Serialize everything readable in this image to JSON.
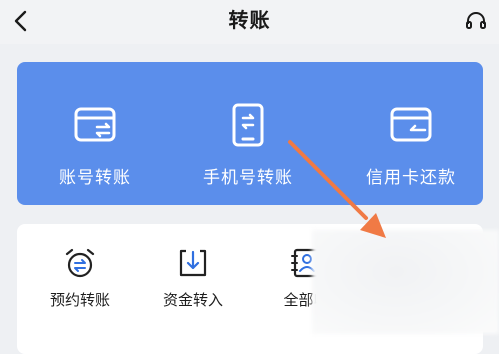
{
  "header": {
    "title": "转账"
  },
  "quick_actions": [
    {
      "label": "账号转账",
      "icon": "card-transfer-icon"
    },
    {
      "label": "手机号转账",
      "icon": "phone-transfer-icon"
    },
    {
      "label": "信用卡还款",
      "icon": "credit-card-repay-icon"
    }
  ],
  "more_actions": [
    {
      "label": "预约转账",
      "icon": "alarm-clock-icon"
    },
    {
      "label": "资金转入",
      "icon": "fund-in-icon"
    },
    {
      "label": "全部收",
      "icon": "payee-contacts-icon"
    }
  ],
  "colors": {
    "primary_card": "#5b8eeb",
    "annotation_arrow": "#f07a45",
    "background": "#eef0f3"
  }
}
